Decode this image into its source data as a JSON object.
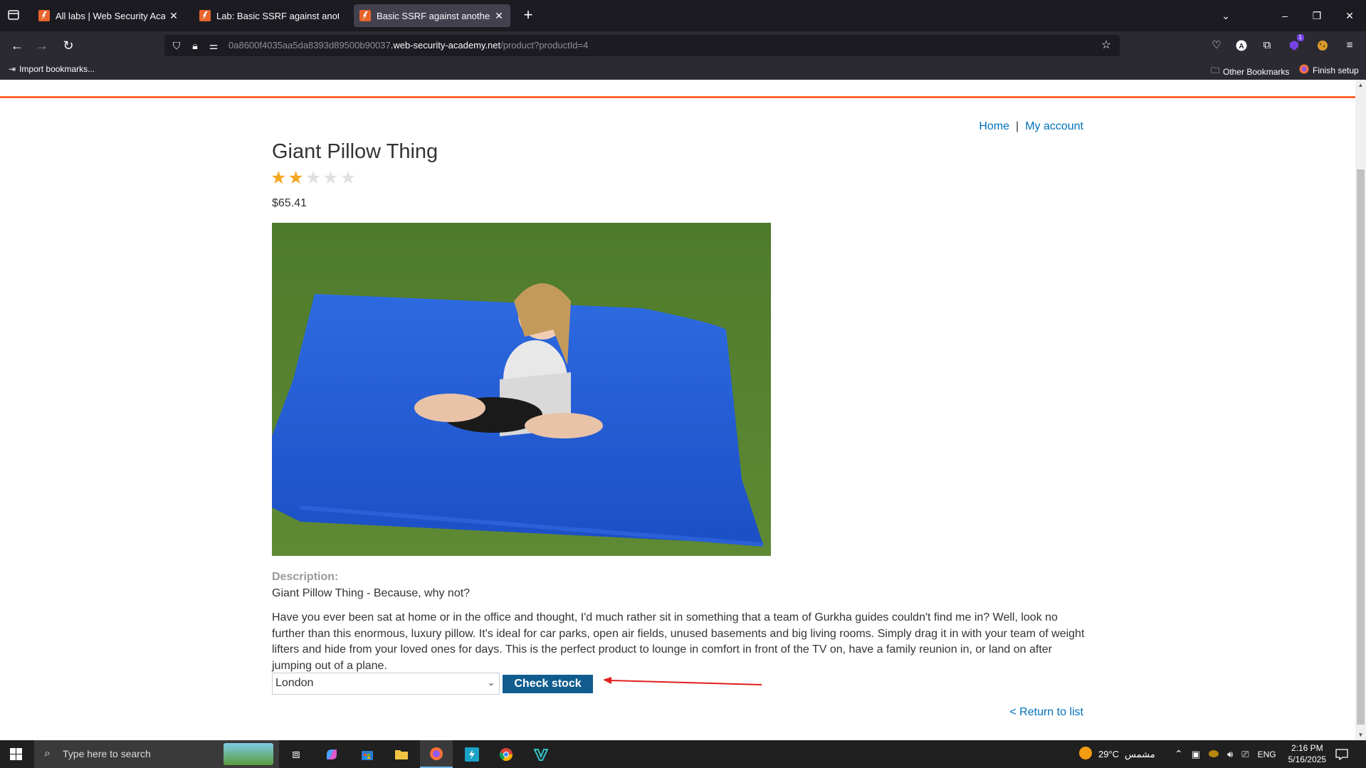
{
  "browser": {
    "tabs": [
      {
        "title": "All labs | Web Security Academy",
        "active": false
      },
      {
        "title": "Lab: Basic SSRF against another",
        "active": false
      },
      {
        "title": "Basic SSRF against another back",
        "active": true
      }
    ],
    "url": {
      "prefix": "0a8600f4035aa5da8393d89500b90037",
      "host": ".web-security-academy.net",
      "path": "/product?productId=4"
    },
    "toolbar_badge": "1",
    "bookmarks": {
      "import": "Import bookmarks...",
      "other": "Other Bookmarks",
      "finish": "Finish setup"
    }
  },
  "page": {
    "nav": {
      "home": "Home",
      "separator": "|",
      "account": "My account"
    },
    "product": {
      "title": "Giant Pillow Thing",
      "rating": 2,
      "rating_max": 5,
      "price": "$65.41",
      "description_label": "Description:",
      "tagline": "Giant Pillow Thing - Because, why not?",
      "description": "Have you ever been sat at home or in the office and thought, I'd much rather sit in something that a team of Gurkha guides couldn't find me in? Well, look no further than this enormous, luxury pillow. It's ideal for car parks, open air fields, unused basements and big living rooms. Simply drag it in with your team of weight lifters and hide from your loved ones for days. This is the perfect product to lounge in comfort in front of the TV on, have a family reunion in, or land on after jumping out of a plane."
    },
    "stock": {
      "selected_store": "London",
      "button": "Check stock"
    },
    "return_link": "< Return to list"
  },
  "taskbar": {
    "search_placeholder": "Type here to search",
    "weather_temp": "29°C",
    "weather_text": "مشمس",
    "language": "ENG",
    "time": "2:16 PM",
    "date": "5/16/2025"
  },
  "colors": {
    "accent": "#ff6633",
    "link": "#0071bc",
    "button": "#115c8f",
    "star_filled": "#f5a623",
    "star_empty": "#e0e0e0",
    "annotation_arrow": "#e0201b"
  }
}
